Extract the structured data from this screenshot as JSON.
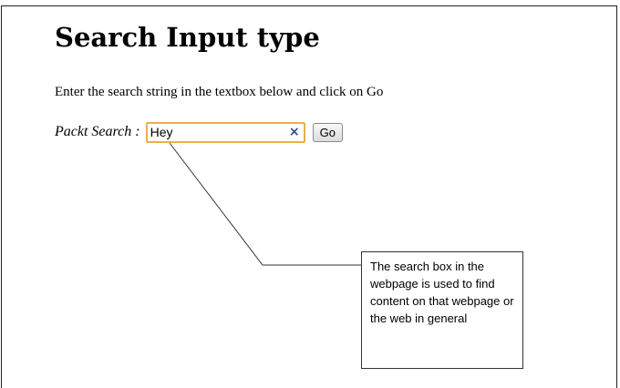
{
  "page": {
    "title": "Search Input type",
    "instructions": "Enter the search string in the textbox below and click on Go"
  },
  "search": {
    "label": "Packt Search :",
    "value": "Hey",
    "clear_icon": "×",
    "go_label": "Go"
  },
  "callout": {
    "text": "The search box in the webpage is used to find content on that webpage or the web in general"
  },
  "colors": {
    "search_border": "#e9b04b",
    "clear_icon": "#2d4a8a"
  },
  "icons": {
    "clear": "close-icon"
  }
}
